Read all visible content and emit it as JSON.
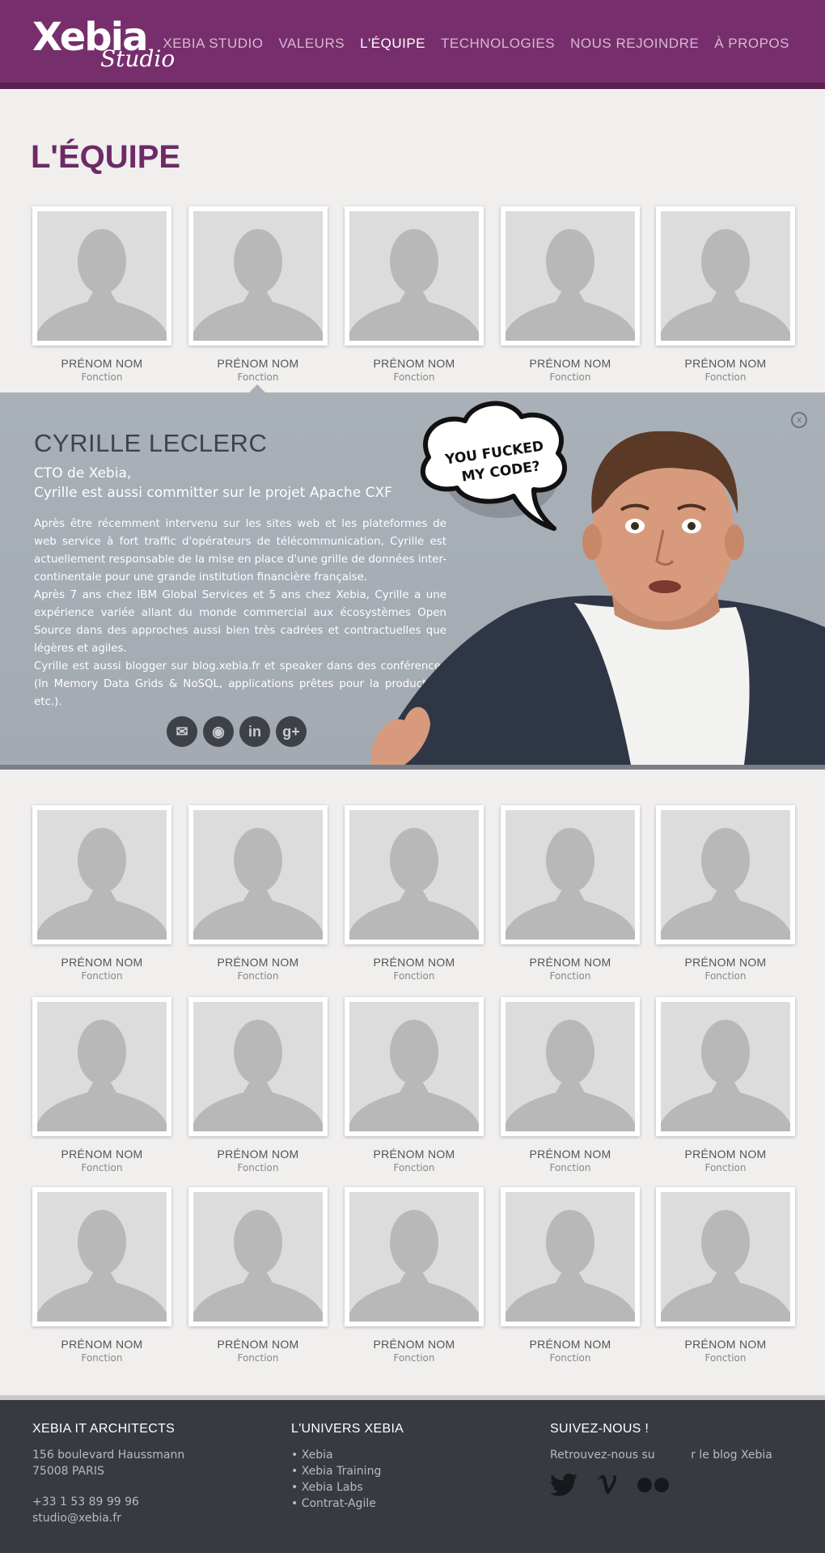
{
  "header": {
    "logo_main": "Xebia",
    "logo_sub": "Studio",
    "nav": [
      {
        "label": "XEBIA STUDIO",
        "active": false
      },
      {
        "label": "VALEURS",
        "active": false
      },
      {
        "label": "L'ÉQUIPE",
        "active": true
      },
      {
        "label": "TECHNOLOGIES",
        "active": false
      },
      {
        "label": "NOUS REJOINDRE",
        "active": false
      },
      {
        "label": "À PROPOS",
        "active": false
      }
    ]
  },
  "page_title": "L'ÉQUIPE",
  "team_card": {
    "name": "PRÉNOM NOM",
    "role": "Fonction"
  },
  "detail": {
    "close": "x",
    "name": "CYRILLE LECLERC",
    "title_line1": "CTO de Xebia,",
    "title_line2": "Cyrille est aussi committer sur le projet Apache CXF",
    "bio": [
      "Après être récemment intervenu sur les sites web et les plateformes de web service à fort traffic d'opérateurs de télécommunication, Cyrille est actuellement responsable de la mise en place d'une grille de données inter-continentale pour une grande institution financière française.",
      "Après 7 ans chez IBM Global Services et 5 ans chez Xebia, Cyrille a une expérience variée allant du monde commercial aux écosystèmes Open Source dans des approches aussi bien très cadrées et contractuelles que légères et agiles.",
      "Cyrille est aussi blogger sur blog.xebia.fr et speaker dans des conférences (In Memory Data Grids & NoSQL, applications prêtes pour la production, etc.)."
    ],
    "bubble_line1": "YOU FUCKED",
    "bubble_line2": "MY CODE?",
    "socials": [
      {
        "icon": "mail-icon",
        "glyph": "✉"
      },
      {
        "icon": "github-icon",
        "glyph": "◉"
      },
      {
        "icon": "linkedin-icon",
        "glyph": "in"
      },
      {
        "icon": "googleplus-icon",
        "glyph": "g+"
      }
    ]
  },
  "footer": {
    "col1": {
      "heading": "XEBIA IT ARCHITECTS",
      "address1": "156 boulevard Haussmann",
      "address2": "75008 PARIS",
      "phone": "+33 1 53 89 99 96",
      "email": "studio@xebia.fr"
    },
    "col2": {
      "heading": "L'UNIVERS XEBIA",
      "links": [
        "• Xebia",
        "• Xebia Training",
        "• Xebia Labs",
        "• Contrat-Agile"
      ]
    },
    "col3": {
      "heading": "SUIVEZ-NOUS !",
      "text": "Retrouvez-nous su          r le blog Xebia",
      "icons": [
        "twitter-icon",
        "vimeo-icon",
        "flickr-icon"
      ]
    }
  },
  "colors": {
    "brand": "#772e6d",
    "panel": "#a9b0b8",
    "footer": "#383a41"
  }
}
